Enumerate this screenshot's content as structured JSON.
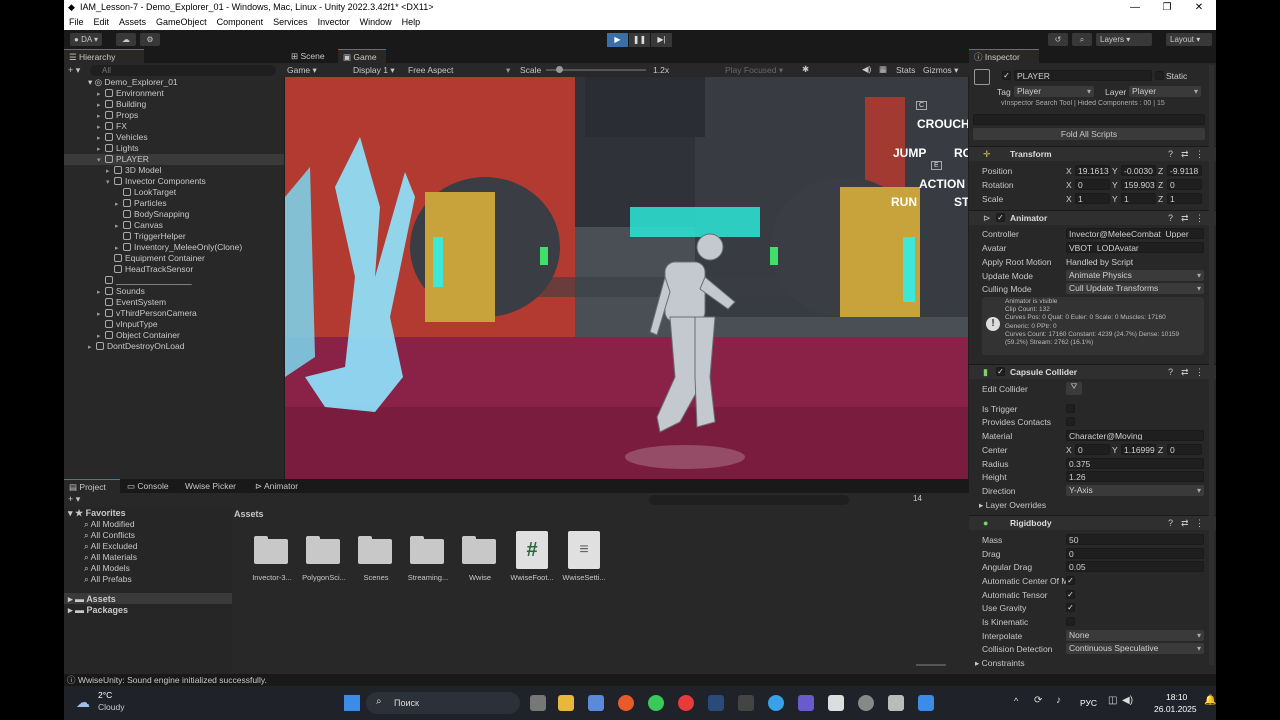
{
  "window": {
    "title": "IAM_Lesson-7 - Demo_Explorer_01 - Windows, Mac, Linux - Unity 2022.3.42f1* <DX11>",
    "controls": [
      "—",
      "❐",
      "✕"
    ]
  },
  "menu": [
    "File",
    "Edit",
    "Assets",
    "GameObject",
    "Component",
    "Services",
    "Invector",
    "Window",
    "Help"
  ],
  "toolbar": {
    "account": "DA",
    "layers": "Layers",
    "layout": "Layout"
  },
  "hierarchy": {
    "tab": "Hierarchy",
    "search_placeholder": "All",
    "scene": "Demo_Explorer_01",
    "items": [
      {
        "label": "Environment"
      },
      {
        "label": "Building"
      },
      {
        "label": "Props"
      },
      {
        "label": "FX"
      },
      {
        "label": "Vehicles"
      },
      {
        "label": "Lights"
      },
      {
        "label": "PLAYER"
      },
      {
        "label": "3D Model"
      },
      {
        "label": "Invector Components"
      },
      {
        "label": "LookTarget"
      },
      {
        "label": "Particles"
      },
      {
        "label": "BodySnapping"
      },
      {
        "label": "Canvas"
      },
      {
        "label": "TriggerHelper"
      },
      {
        "label": "Inventory_MeleeOnly(Clone)"
      },
      {
        "label": "Equipment Container"
      },
      {
        "label": "HeadTrackSensor"
      },
      {
        "label": "________________"
      },
      {
        "label": "Sounds"
      },
      {
        "label": "EventSystem"
      },
      {
        "label": "vThirdPersonCamera"
      },
      {
        "label": "vInputType"
      },
      {
        "label": "Object Container"
      },
      {
        "label": "DontDestroyOnLoad"
      }
    ]
  },
  "game": {
    "tabs": [
      "Scene",
      "Game"
    ],
    "mode": "Game",
    "display": "Display 1",
    "aspect": "Free Aspect",
    "scale_label": "Scale",
    "scale_value": "1.2x",
    "play_focused": "Play Focused",
    "stats": "Stats",
    "gizmos": "Gizmos",
    "hud": {
      "crouch": "CROUCH",
      "jump": "JUMP",
      "roll": "RO",
      "action": "ACTION",
      "run": "RUN",
      "st": "ST",
      "key_c": "C",
      "key_e": "E"
    }
  },
  "inspector": {
    "tab": "Inspector",
    "object_name": "PLAYER",
    "static": "Static",
    "tag_label": "Tag",
    "tag": "Player",
    "layer_label": "Layer",
    "layer": "Player",
    "vinspector": "vInspector Search Tool | Hided Components : 00 | 15",
    "fold_all": "Fold All Scripts",
    "transform": {
      "name": "Transform",
      "position_label": "Position",
      "position": [
        "19.1613",
        "-0.0030",
        "-9.9118"
      ],
      "rotation_label": "Rotation",
      "rotation": [
        "0",
        "159.903",
        "0"
      ],
      "scale_label": "Scale",
      "scale": [
        "1",
        "1",
        "1"
      ]
    },
    "animator": {
      "name": "Animator",
      "controller_label": "Controller",
      "controller": "Invector@MeleeCombat_Upper",
      "avatar_label": "Avatar",
      "avatar": "VBOT_LODAvatar",
      "root_motion_label": "Apply Root Motion",
      "root_motion": "Handled by Script",
      "update_mode_label": "Update Mode",
      "update_mode": "Animate Physics",
      "culling_label": "Culling Mode",
      "culling": "Cull Update Transforms",
      "info": [
        "Animator is visible",
        "Clip Count: 132",
        "Curves Pos: 0 Quat: 0 Euler: 0 Scale: 0 Muscles: 17160",
        "Generic: 0 PPtr: 0",
        "Curves Count: 17160 Constant: 4239 (24.7%) Dense: 10159",
        "(59.2%) Stream: 2762 (16.1%)"
      ]
    },
    "capsule": {
      "name": "Capsule Collider",
      "edit_label": "Edit Collider",
      "trigger_label": "Is Trigger",
      "contacts_label": "Provides Contacts",
      "material_label": "Material",
      "material": "Character@Moving",
      "center_label": "Center",
      "center": [
        "0",
        "1.16999",
        "0"
      ],
      "radius_label": "Radius",
      "radius": "0.375",
      "height_label": "Height",
      "height": "1.26",
      "direction_label": "Direction",
      "direction": "Y-Axis",
      "overrides_label": "Layer Overrides"
    },
    "rigidbody": {
      "name": "Rigidbody",
      "mass_label": "Mass",
      "mass": "50",
      "drag_label": "Drag",
      "drag": "0",
      "ang_drag_label": "Angular Drag",
      "ang_drag": "0.05",
      "auto_com_label": "Automatic Center Of M",
      "auto_tensor_label": "Automatic Tensor",
      "gravity_label": "Use Gravity",
      "kinematic_label": "Is Kinematic",
      "interp_label": "Interpolate",
      "interp": "None",
      "collision_label": "Collision Detection",
      "collision": "Continuous Speculative",
      "constraints_label": "Constraints"
    },
    "axis": [
      "X",
      "Y",
      "Z"
    ]
  },
  "project": {
    "tabs": [
      "Project",
      "Console",
      "Wwise Picker",
      "Animator"
    ],
    "favorites": "Favorites",
    "fav_items": [
      "All Modified",
      "All Conflicts",
      "All Excluded",
      "All Materials",
      "All Models",
      "All Prefabs"
    ],
    "roots": [
      "Assets",
      "Packages"
    ],
    "path": "Assets",
    "count": "14",
    "assets": [
      {
        "label": "Invector-3..."
      },
      {
        "label": "PolygonSci..."
      },
      {
        "label": "Scenes"
      },
      {
        "label": "Streaming..."
      },
      {
        "label": "Wwise"
      },
      {
        "label": "WwiseFoot..."
      },
      {
        "label": "WwiseSetti..."
      }
    ]
  },
  "status": "WwiseUnity: Sound engine initialized successfully.",
  "taskbar": {
    "temp": "2°C",
    "weather": "Cloudy",
    "search": "Поиск",
    "lang": "РУС",
    "time": "18:10",
    "date": "26.01.2025"
  },
  "colors": {
    "accent": "#3a79bb",
    "panel": "#282828",
    "dark": "#191919"
  }
}
